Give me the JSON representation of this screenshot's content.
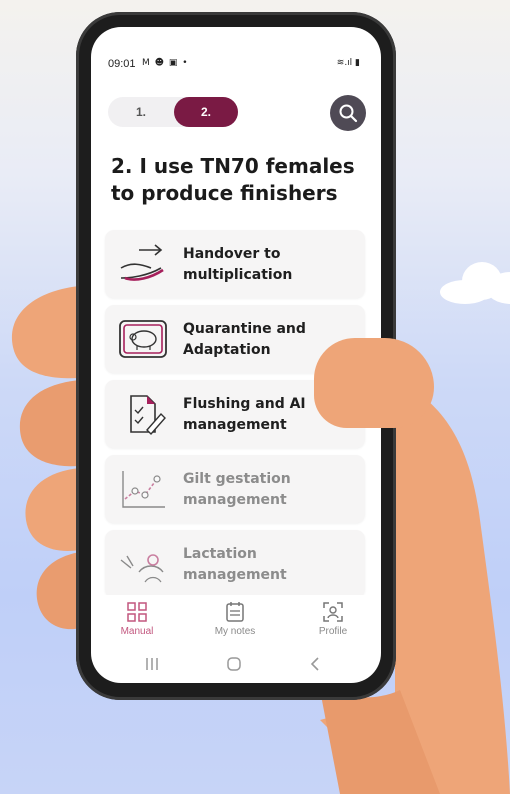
{
  "status_bar": {
    "time": "09:01",
    "left_icons": "M ☻ ▣ •",
    "right_icons": "≋.ıl ▮"
  },
  "stepper": {
    "steps": [
      "1.",
      "2."
    ],
    "active_index": 1
  },
  "page_title": "2. I use TN70 females to produce finishers",
  "menu_items": [
    {
      "label": "Handover to\nmultiplication",
      "icon": "hand-arrow-icon",
      "dimmed": false
    },
    {
      "label": "Quarantine and\nAdaptation",
      "icon": "pig-frame-icon",
      "dimmed": false
    },
    {
      "label": "Flushing and AI\nmanagement",
      "icon": "checklist-pen-icon",
      "dimmed": false
    },
    {
      "label": "Gilt gestation\nmanagement",
      "icon": "growth-chart-icon",
      "dimmed": true
    },
    {
      "label": "Lactation\nmanagement",
      "icon": "sow-piglets-icon",
      "dimmed": true
    }
  ],
  "bottom_nav": [
    {
      "label": "Manual",
      "icon": "grid-icon",
      "active": true
    },
    {
      "label": "My notes",
      "icon": "notepad-icon",
      "active": false
    },
    {
      "label": "Profile",
      "icon": "profile-scan-icon",
      "active": false
    }
  ],
  "colors": {
    "accent": "#7a1a44",
    "accent_light": "#c2577f",
    "search_button": "#4f4a55",
    "skin": "#eea578"
  }
}
